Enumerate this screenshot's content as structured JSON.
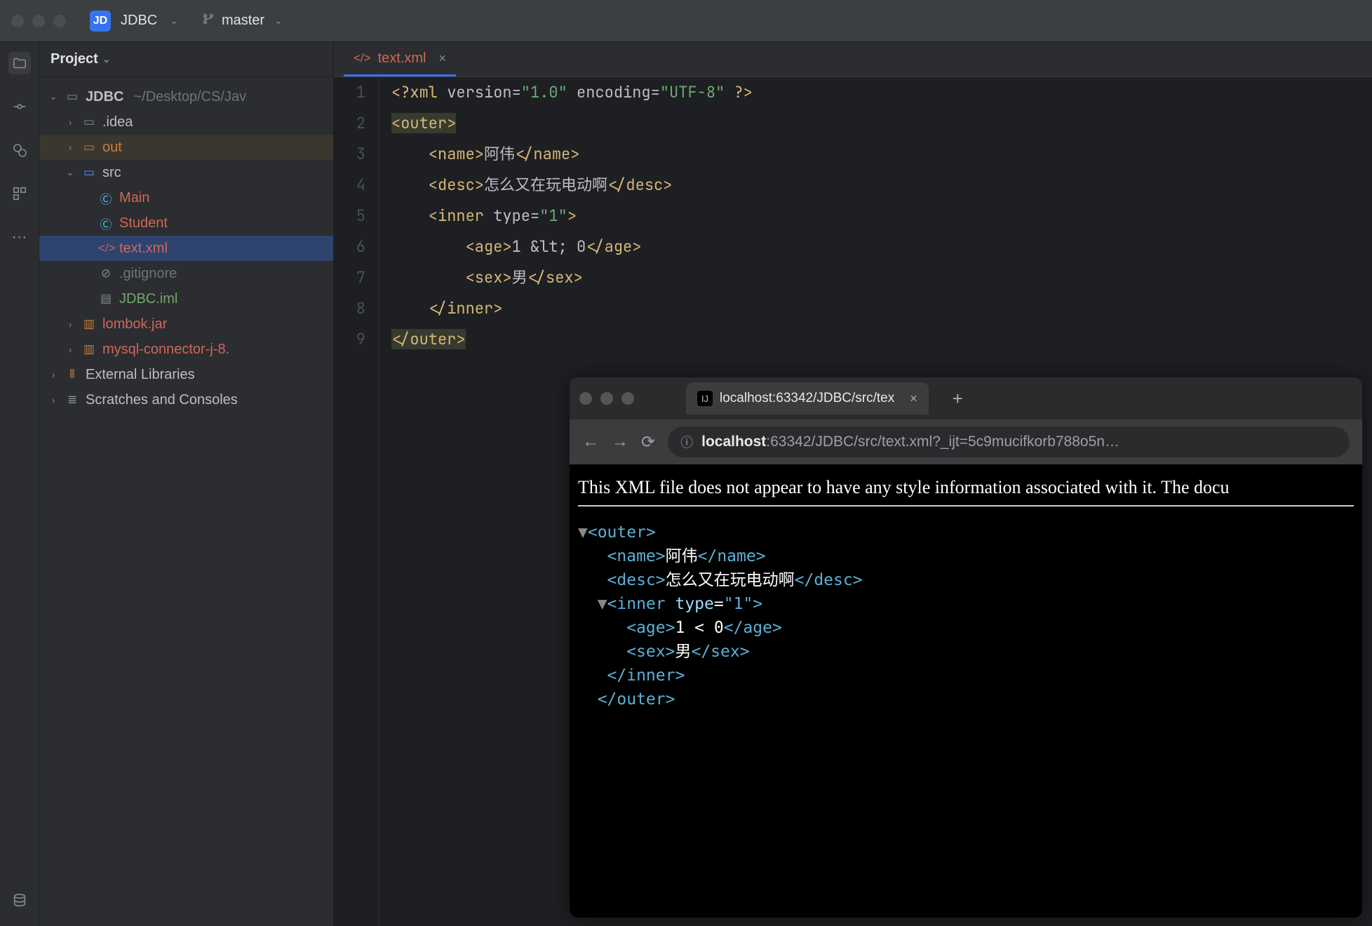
{
  "titlebar": {
    "badge": "JD",
    "project": "JDBC",
    "branch": "master"
  },
  "panel": {
    "title": "Project"
  },
  "tree": {
    "root": "JDBC",
    "root_path": "~/Desktop/CS/Jav",
    "idea": ".idea",
    "out": "out",
    "src": "src",
    "main": "Main",
    "student": "Student",
    "textxml": "text.xml",
    "gitignore": ".gitignore",
    "iml": "JDBC.iml",
    "lombok": "lombok.jar",
    "mysql": "mysql-connector-j-8.",
    "extlib": "External Libraries",
    "scratches": "Scratches and Consoles"
  },
  "tab": {
    "label": "text.xml"
  },
  "code": {
    "lines": [
      "1",
      "2",
      "3",
      "4",
      "5",
      "6",
      "7",
      "8",
      "9"
    ],
    "l1a": "<?xml ",
    "l1b": "version",
    "l1c": "=",
    "l1d": "\"1.0\"",
    "l1e": " encoding",
    "l1f": "=",
    "l1g": "\"UTF-8\"",
    "l1h": " ?>",
    "l2a": "<outer>",
    "l3a": "    <name>",
    "l3b": "阿伟",
    "l3c": "</name>",
    "l4a": "    <desc>",
    "l4b": "怎么又在玩电动啊",
    "l4c": "</desc>",
    "l5a": "    <inner ",
    "l5b": "type",
    "l5c": "=",
    "l5d": "\"1\"",
    "l5e": ">",
    "l6a": "        <age>",
    "l6b": "1 &lt; 0",
    "l6c": "</age>",
    "l7a": "        <sex>",
    "l7b": "男",
    "l7c": "</sex>",
    "l8a": "    </inner>",
    "l9a": "</outer>"
  },
  "browser": {
    "tab_title": "localhost:63342/JDBC/src/tex",
    "url_host": "localhost",
    "url_rest": ":63342/JDBC/src/text.xml?_ijt=5c9mucifkorb788o5n…",
    "msg": "This XML file does not appear to have any style information associated with it. The docu",
    "x": {
      "r1": "▼",
      "r1b": "<outer>",
      "r2a": "   <name>",
      "r2b": "阿伟",
      "r2c": "</name>",
      "r3a": "   <desc>",
      "r3b": "怎么又在玩电动啊",
      "r3c": "</desc>",
      "r4a": "  ▼",
      "r4b": "<inner ",
      "r4c": "type",
      "r4d": "=",
      "r4e": "\"1\"",
      "r4f": ">",
      "r5a": "     <age>",
      "r5b": "1 < 0",
      "r5c": "</age>",
      "r6a": "     <sex>",
      "r6b": "男",
      "r6c": "</sex>",
      "r7a": "   </inner>",
      "r8a": "  </outer>"
    }
  }
}
